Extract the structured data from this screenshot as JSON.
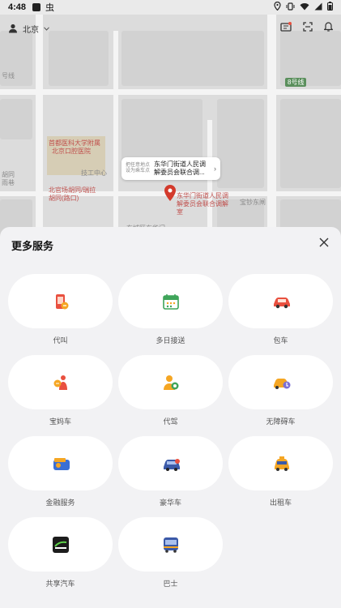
{
  "status_bar": {
    "time": "4:48",
    "app_glyph": "虫"
  },
  "topbar": {
    "city": "北京"
  },
  "map": {
    "labels": {
      "road_ring": "8号线",
      "north_road": "8号线",
      "west_top": "号线",
      "hospital_1": "首都医科大学附属",
      "hospital_2": "北京口腔医院",
      "school": "技工中心",
      "hutong_1": "胡同",
      "hutong_2": "雨巷",
      "beiguan_1": "北官场胡同/瑞拉",
      "beiguan_2": "胡同(路口)",
      "east": "宝钞东闸",
      "pin_1": "东华门街道人民调",
      "pin_2": "解委员会联合调解",
      "pin_3": "室",
      "bottom": "东城区东华门"
    },
    "callout": {
      "small": "把任意地点设为乘车点",
      "big": "东华门街道人民调解委员会联合调..."
    }
  },
  "sheet": {
    "title": "更多服务",
    "services": [
      {
        "label": "代叫",
        "icon": "phone-call-icon"
      },
      {
        "label": "多日接送",
        "icon": "calendar-icon"
      },
      {
        "label": "包车",
        "icon": "car-red-icon"
      },
      {
        "label": "宝妈车",
        "icon": "mother-icon"
      },
      {
        "label": "代驾",
        "icon": "driver-icon"
      },
      {
        "label": "无障碍车",
        "icon": "accessible-car-icon"
      },
      {
        "label": "金融服务",
        "icon": "wallet-icon"
      },
      {
        "label": "豪华车",
        "icon": "luxury-car-icon"
      },
      {
        "label": "出租车",
        "icon": "taxi-icon"
      },
      {
        "label": "共享汽车",
        "icon": "gofun-icon"
      },
      {
        "label": "巴士",
        "icon": "bus-icon"
      }
    ]
  },
  "colors": {
    "accent_orange": "#f5a623",
    "accent_red": "#e9503f",
    "accent_green": "#3fa55a",
    "accent_blue": "#3b6fd4"
  }
}
